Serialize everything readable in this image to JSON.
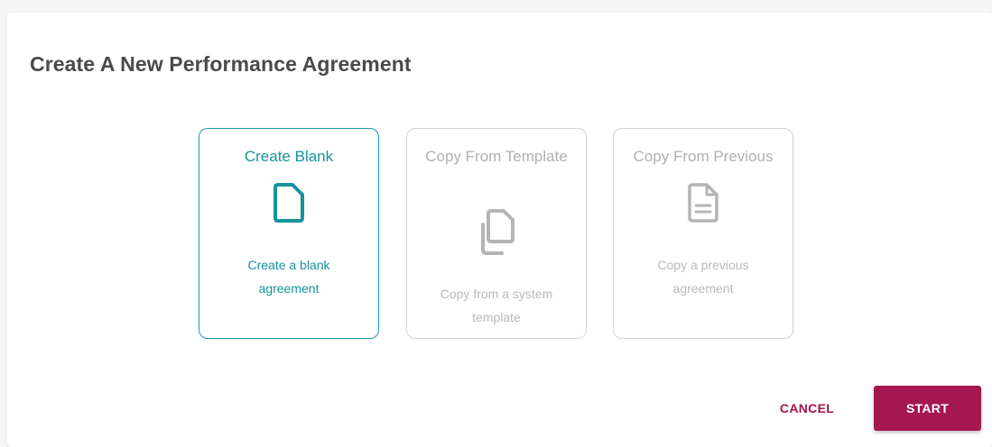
{
  "dialog": {
    "title": "Create A New Performance Agreement"
  },
  "options": [
    {
      "label": "Create Blank",
      "description": "Create a blank agreement",
      "icon": "blank-document-icon",
      "selected": true
    },
    {
      "label": "Copy From Template",
      "description": "Copy from a system template",
      "icon": "copy-icon",
      "selected": false
    },
    {
      "label": "Copy From Previous",
      "description": "Copy a previous agreement",
      "icon": "text-document-icon",
      "selected": false
    }
  ],
  "actions": {
    "cancel_label": "CANCEL",
    "start_label": "START"
  },
  "colors": {
    "accent": "#16939c",
    "primary": "#a5174f",
    "muted": "#b0b0b0"
  }
}
